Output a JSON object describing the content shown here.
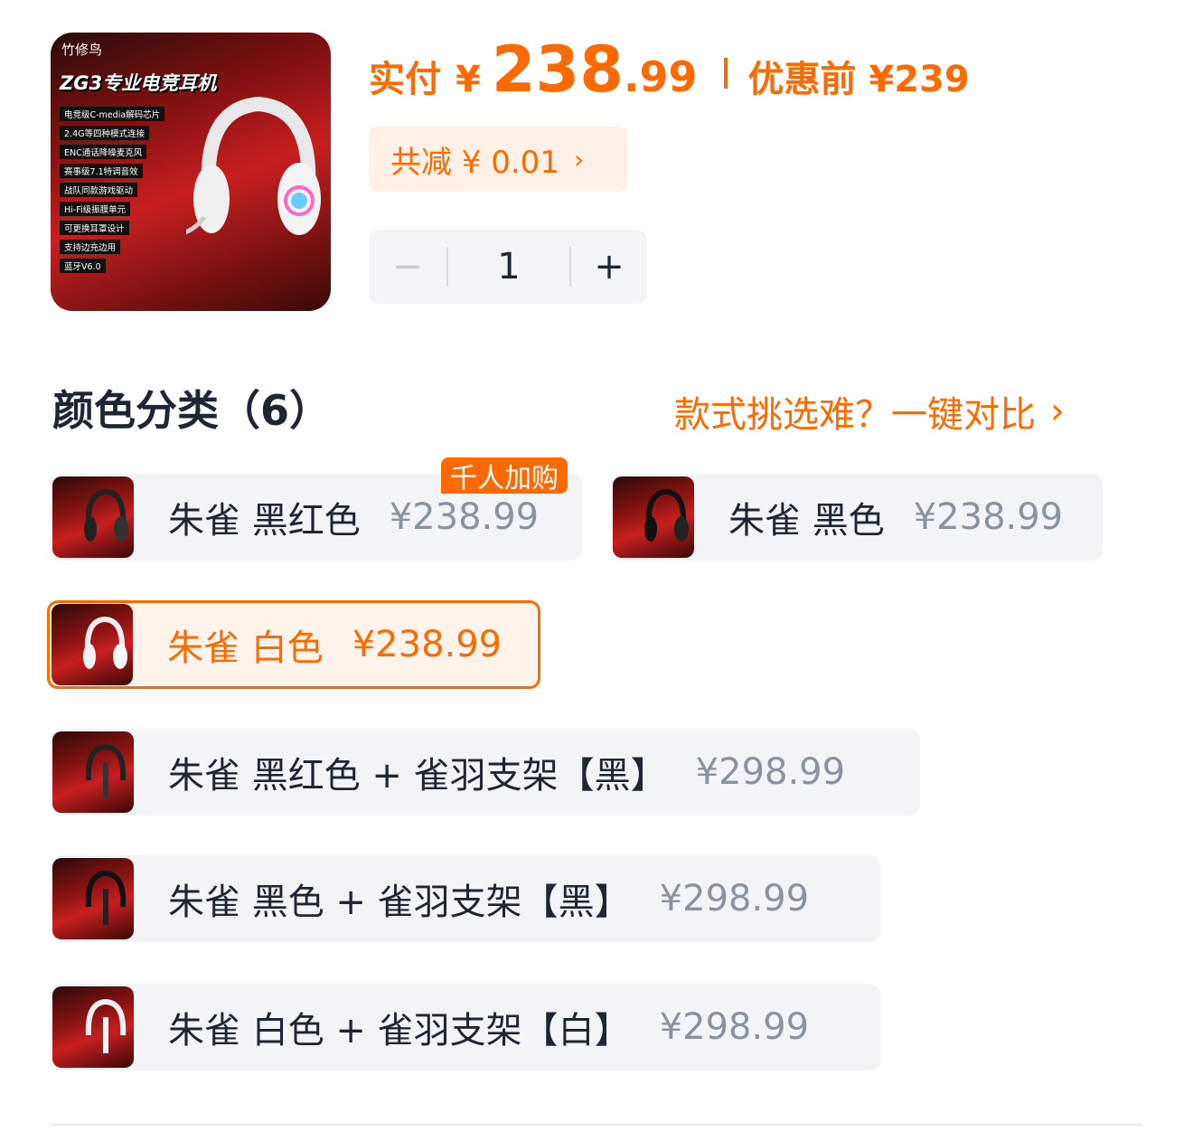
{
  "product": {
    "brand": "竹修鸟",
    "headline": "ZG3专业电竞耳机",
    "features": [
      "电竞级C-media解码芯片",
      "2.4G等四种模式连接",
      "ENC通话降噪麦克风",
      "赛事级7.1特调音效",
      "战队同款游戏驱动",
      "Hi-Fi级振膜单元",
      "可更换耳罩设计",
      "支持边充边用",
      "蓝牙V6.0"
    ]
  },
  "price": {
    "pay_label": "实付",
    "currency": "¥",
    "integer": "238",
    "decimal": ".99",
    "original": "优惠前 ¥239"
  },
  "discount": {
    "label": "共减 ¥ 0.01",
    "chevron": "›"
  },
  "stepper": {
    "minus": "−",
    "quantity": "1",
    "plus": "+"
  },
  "section": {
    "title": "颜色分类（6）",
    "compare": "款式挑选难？一键对比",
    "compare_chevron": "›"
  },
  "badge": "千人加购",
  "variants": [
    {
      "name": "朱雀 黑红色",
      "price": "¥238.99",
      "selected": false
    },
    {
      "name": "朱雀 黑色",
      "price": "¥238.99",
      "selected": false
    },
    {
      "name": "朱雀 白色",
      "price": "¥238.99",
      "selected": true
    },
    {
      "name": "朱雀 黑红色 + 雀羽支架【黑】",
      "price": "¥298.99",
      "selected": false
    },
    {
      "name": "朱雀 黑色 + 雀羽支架【黑】",
      "price": "¥298.99",
      "selected": false
    },
    {
      "name": "朱雀 白色 + 雀羽支架【白】",
      "price": "¥298.99",
      "selected": false
    }
  ],
  "colors": {
    "accent": "#ff6a00",
    "text": "#1f2633",
    "muted": "#8a93a0",
    "chip": "#f2f4f6"
  }
}
